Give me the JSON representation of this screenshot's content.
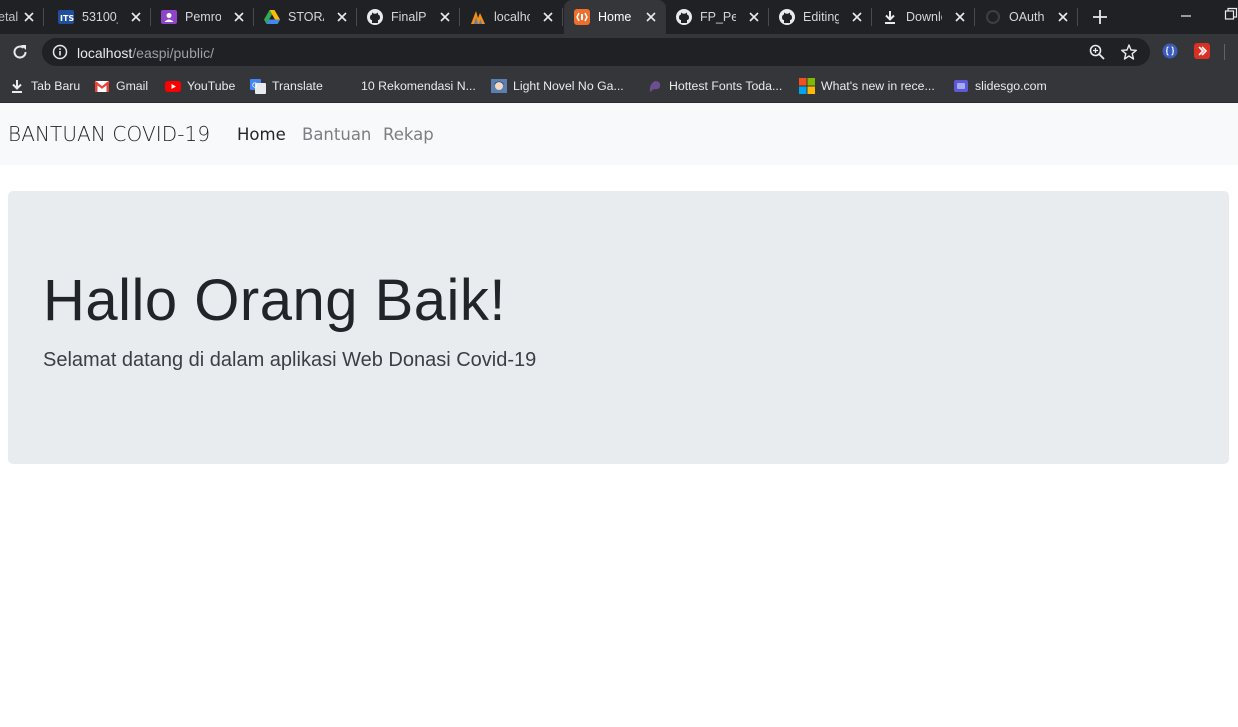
{
  "browser": {
    "tabs": [
      {
        "label": "etal",
        "icon": "page-icon",
        "active": false
      },
      {
        "label": "53100_",
        "icon": "its-logo-icon",
        "active": false
      },
      {
        "label": "Pemrog",
        "icon": "classroom-icon",
        "active": false
      },
      {
        "label": "STORAGE",
        "icon": "google-drive-icon",
        "active": false
      },
      {
        "label": "FinalProject",
        "icon": "github-icon",
        "active": false
      },
      {
        "label": "localhost",
        "icon": "phpmyadmin-icon",
        "active": false
      },
      {
        "label": "Home",
        "icon": "codeigniter-icon",
        "active": true
      },
      {
        "label": "FP_Pem",
        "icon": "github-icon",
        "active": false
      },
      {
        "label": "Editing",
        "icon": "github-icon",
        "active": false
      },
      {
        "label": "Download",
        "icon": "download-icon",
        "active": false
      },
      {
        "label": "OAuth",
        "icon": "loading-icon",
        "active": false
      }
    ],
    "address_bar": {
      "host": "localhost",
      "path": "/easpi/public/"
    },
    "bookmarks": [
      {
        "label": "Tab Baru",
        "icon": "download-icon"
      },
      {
        "label": "Gmail",
        "icon": "gmail-icon"
      },
      {
        "label": "YouTube",
        "icon": "youtube-icon"
      },
      {
        "label": "Translate",
        "icon": "translate-icon"
      },
      {
        "label": "10 Rekomendasi N...",
        "icon": "blank-icon"
      },
      {
        "label": "Light Novel No Ga...",
        "icon": "anime-icon"
      },
      {
        "label": "Hottest Fonts Toda...",
        "icon": "font-icon"
      },
      {
        "label": "What's new in rece...",
        "icon": "microsoft-icon"
      },
      {
        "label": "slidesgo.com",
        "icon": "slidesgo-icon"
      }
    ]
  },
  "page": {
    "navbar": {
      "brand": "BANTUAN COVID-19",
      "links": [
        {
          "label": "Home",
          "active": true
        },
        {
          "label": "Bantuan",
          "active": false
        },
        {
          "label": "Rekap",
          "active": false
        }
      ]
    },
    "jumbotron": {
      "title": "Hallo Orang Baik!",
      "lead": "Selamat datang di dalam aplikasi Web Donasi Covid-19"
    }
  },
  "colors": {
    "tabstrip_bg": "#202124",
    "toolbar_bg": "#35363a",
    "navbar_bg": "#f8f9fa",
    "jumbotron_bg": "#e9ecef"
  }
}
